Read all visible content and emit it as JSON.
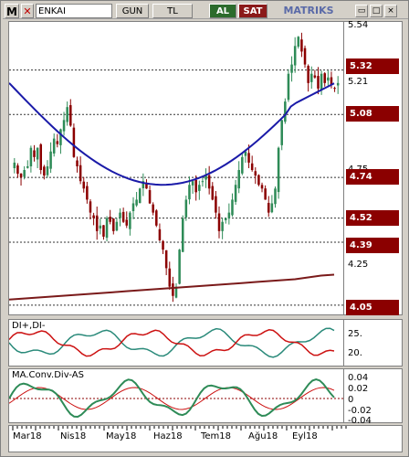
{
  "toolbar": {
    "menu_glyph": "M",
    "close_glyph": "✕",
    "symbol": "ENKAI",
    "period_label": "GUN",
    "currency_label": "TL",
    "buy_label": "AL",
    "sell_label": "SAT",
    "brand": "MATRIKS",
    "window_buttons": [
      "▭",
      "□",
      "×"
    ]
  },
  "price_axis": {
    "levels": [
      {
        "value": "5.54",
        "boxed": false
      },
      {
        "value": "5.32",
        "boxed": true
      },
      {
        "value": "5.21",
        "boxed": false
      },
      {
        "value": "5.08",
        "boxed": true
      },
      {
        "value": "4.75",
        "boxed": false
      },
      {
        "value": "4.74",
        "boxed": true
      },
      {
        "value": "4.52",
        "boxed": true
      },
      {
        "value": "4.39",
        "boxed": true
      },
      {
        "value": "4.25",
        "boxed": false
      },
      {
        "value": "4.05",
        "boxed": true
      }
    ]
  },
  "dmi_panel": {
    "label": "DI+,DI-",
    "axis": [
      "25.",
      "20."
    ]
  },
  "macd_panel": {
    "label": "MA.Conv.Div-AS",
    "axis": [
      "0.04",
      "0.02",
      "0",
      "-0.02",
      "-0.04"
    ]
  },
  "date_axis": [
    "Mar18",
    "Nis18",
    "May18",
    "Haz18",
    "Tem18",
    "Ağu18",
    "Eyl18"
  ],
  "colors": {
    "candle_up": "#2e8b57",
    "candle_down": "#8b0000",
    "ma_blue": "#1a1aa8",
    "ma_brown": "#7a1a1a",
    "di_plus": "#2a8a7a",
    "di_minus": "#cc1111",
    "macd": "#2e8b57",
    "signal": "#cc1111"
  },
  "chart_data": {
    "type": "candlestick",
    "ylim": [
      4.0,
      5.58
    ],
    "closes": [
      4.82,
      4.76,
      4.74,
      4.78,
      4.8,
      4.9,
      4.85,
      4.9,
      4.78,
      4.75,
      4.8,
      4.88,
      4.95,
      4.92,
      5.0,
      5.05,
      5.12,
      5.02,
      4.85,
      4.8,
      4.72,
      4.68,
      4.62,
      4.55,
      4.52,
      4.45,
      4.48,
      4.42,
      4.52,
      4.5,
      4.45,
      4.5,
      4.55,
      4.5,
      4.48,
      4.55,
      4.6,
      4.62,
      4.68,
      4.72,
      4.68,
      4.6,
      4.55,
      4.48,
      4.4,
      4.35,
      4.25,
      4.15,
      4.1,
      4.15,
      4.35,
      4.52,
      4.62,
      4.7,
      4.72,
      4.66,
      4.7,
      4.72,
      4.75,
      4.68,
      4.62,
      4.55,
      4.45,
      4.5,
      4.52,
      4.55,
      4.62,
      4.7,
      4.78,
      4.85,
      4.88,
      4.82,
      4.78,
      4.75,
      4.7,
      4.68,
      4.62,
      4.55,
      4.6,
      4.68,
      4.9,
      5.05,
      5.15,
      5.3,
      5.35,
      5.45,
      5.5,
      5.42,
      5.35,
      5.25,
      5.3,
      5.28,
      5.22,
      5.3,
      5.25,
      5.28,
      5.24,
      5.22,
      5.25
    ],
    "ma_long": [
      4.08,
      4.085,
      4.09,
      4.095,
      4.1,
      4.105,
      4.11,
      4.115,
      4.12,
      4.125,
      4.13,
      4.135,
      4.14,
      4.145,
      4.15,
      4.155,
      4.16,
      4.165,
      4.17,
      4.175,
      4.18,
      4.185,
      4.19,
      4.2,
      4.21,
      4.215
    ]
  }
}
